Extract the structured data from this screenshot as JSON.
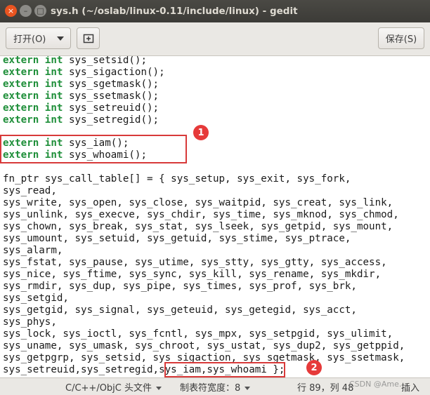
{
  "window": {
    "title": "sys.h (~/oslab/linux-0.11/include/linux) - gedit",
    "close_glyph": "×",
    "minimize_glyph": "–",
    "maximize_glyph": "□"
  },
  "toolbar": {
    "open_label": "打开(O)",
    "newtab_glyph": "⊞",
    "save_label": "保存(S)"
  },
  "editor": {
    "keyword_color": "#1f8f3a",
    "decl_lines": [
      {
        "kw1": "extern",
        "kw2": "int",
        "rest": " sys_setsid();"
      },
      {
        "kw1": "extern",
        "kw2": "int",
        "rest": " sys_sigaction();"
      },
      {
        "kw1": "extern",
        "kw2": "int",
        "rest": " sys_sgetmask();"
      },
      {
        "kw1": "extern",
        "kw2": "int",
        "rest": " sys_ssetmask();"
      },
      {
        "kw1": "extern",
        "kw2": "int",
        "rest": " sys_setreuid();"
      },
      {
        "kw1": "extern",
        "kw2": "int",
        "rest": " sys_setregid();"
      }
    ],
    "added_lines": [
      {
        "kw1": "extern",
        "kw2": "int",
        "rest": " sys_iam();"
      },
      {
        "kw1": "extern",
        "kw2": "int",
        "rest": " sys_whoami();"
      }
    ],
    "table_lines": [
      "fn_ptr sys_call_table[] = { sys_setup, sys_exit, sys_fork,",
      "sys_read,",
      "sys_write, sys_open, sys_close, sys_waitpid, sys_creat, sys_link,",
      "sys_unlink, sys_execve, sys_chdir, sys_time, sys_mknod, sys_chmod,",
      "sys_chown, sys_break, sys_stat, sys_lseek, sys_getpid, sys_mount,",
      "sys_umount, sys_setuid, sys_getuid, sys_stime, sys_ptrace,",
      "sys_alarm,",
      "sys_fstat, sys_pause, sys_utime, sys_stty, sys_gtty, sys_access,",
      "sys_nice, sys_ftime, sys_sync, sys_kill, sys_rename, sys_mkdir,",
      "sys_rmdir, sys_dup, sys_pipe, sys_times, sys_prof, sys_brk,",
      "sys_setgid,",
      "sys_getgid, sys_signal, sys_geteuid, sys_getegid, sys_acct,",
      "sys_phys,",
      "sys_lock, sys_ioctl, sys_fcntl, sys_mpx, sys_setpgid, sys_ulimit,",
      "sys_uname, sys_umask, sys_chroot, sys_ustat, sys_dup2, sys_getppid,",
      "sys_getpgrp, sys_setsid, sys_sigaction, sys_sgetmask, sys_ssetmask,"
    ],
    "last_line": {
      "prefix": "sys_setreuid,sys_setregid,",
      "highlight": "sys_iam,sys_whoami",
      "suffix": " };"
    },
    "annotations": {
      "badge1": "1",
      "badge2": "2",
      "color": "#e63a3a"
    }
  },
  "statusbar": {
    "language": "C/C++/ObjC 头文件",
    "tab_width": "制表符宽度：8",
    "position": "行 89，列 48",
    "mode": "插入"
  },
  "watermark": "CSDN @Ame…"
}
